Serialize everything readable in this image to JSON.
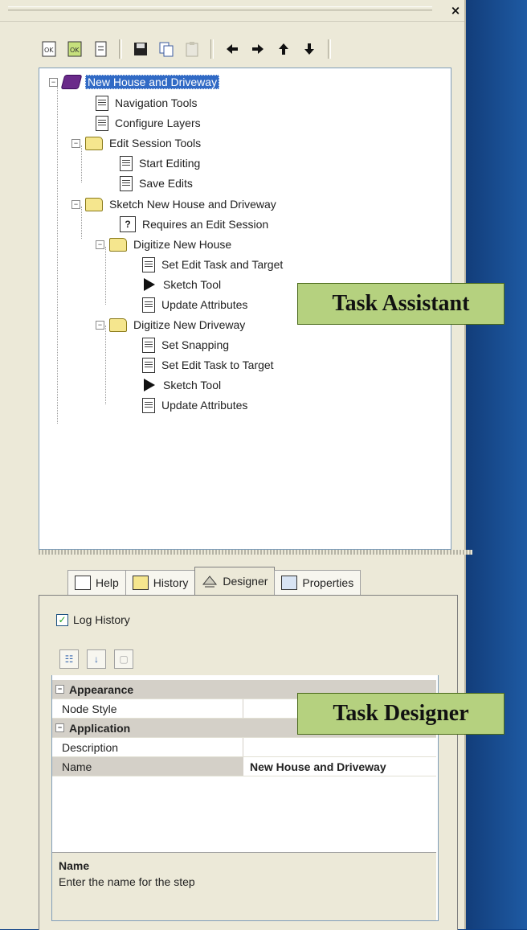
{
  "tree": {
    "nodes": [
      {
        "label": "New House and Driveway",
        "icon": "book-icon",
        "selected": true
      },
      {
        "label": "Navigation Tools",
        "icon": "document-icon"
      },
      {
        "label": "Configure Layers",
        "icon": "document-icon"
      },
      {
        "label": "Edit Session Tools",
        "icon": "folder-icon"
      },
      {
        "label": "Start Editing",
        "icon": "document-icon"
      },
      {
        "label": "Save Edits",
        "icon": "document-icon"
      },
      {
        "label": "Sketch New House and Driveway",
        "icon": "folder-icon"
      },
      {
        "label": "Requires an Edit Session",
        "icon": "help-icon"
      },
      {
        "label": "Digitize New House",
        "icon": "folder-icon"
      },
      {
        "label": "Set Edit Task and Target",
        "icon": "document-icon"
      },
      {
        "label": "Sketch Tool",
        "icon": "play-icon"
      },
      {
        "label": "Update Attributes",
        "icon": "document-icon"
      },
      {
        "label": "Digitize New Driveway",
        "icon": "folder-icon"
      },
      {
        "label": "Set Snapping",
        "icon": "document-icon"
      },
      {
        "label": "Set Edit Task to Target",
        "icon": "document-icon"
      },
      {
        "label": "Sketch Tool",
        "icon": "play-icon"
      },
      {
        "label": "Update Attributes",
        "icon": "document-icon"
      }
    ]
  },
  "callouts": {
    "assistant": "Task Assistant",
    "designer": "Task Designer"
  },
  "tabs": [
    "Help",
    "History",
    "Designer",
    "Properties"
  ],
  "log_history": "Log History",
  "properties": {
    "cat_appearance": "Appearance",
    "node_style": "Node Style",
    "cat_application": "Application",
    "description": "Description",
    "name": "Name",
    "name_value": "New House and Driveway"
  },
  "desc_pane": {
    "title": "Name",
    "text": "Enter the name for the step"
  },
  "colors": {
    "background": "#1656a6",
    "selection": "#316ac5",
    "callout": "#b5d17f"
  }
}
